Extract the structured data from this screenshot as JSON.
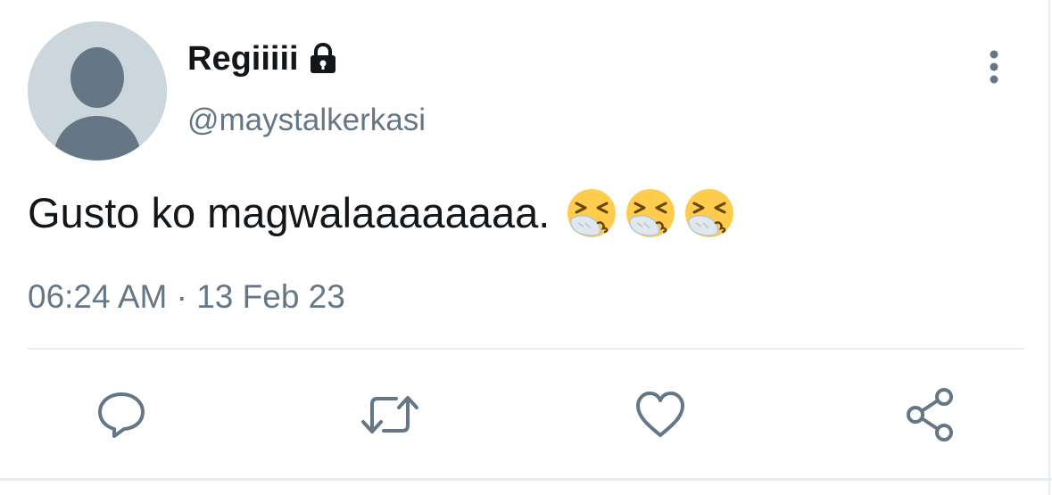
{
  "tweet": {
    "display_name": "Regiiiii",
    "handle": "@maystalkerkasi",
    "text": "Gusto ko magwalaaaaaaaa.",
    "emojis": [
      "sneezing-face-icon",
      "sneezing-face-icon",
      "sneezing-face-icon"
    ],
    "timestamp": "06:24 AM · 13 Feb 23",
    "protected_icon": "lock-icon"
  },
  "actions": {
    "reply_icon": "reply-icon",
    "retweet_icon": "retweet-icon",
    "like_icon": "heart-icon",
    "share_icon": "share-icon"
  },
  "colors": {
    "text_primary": "#14171a",
    "text_secondary": "#657786",
    "avatar_bg": "#ccd6dd",
    "avatar_fg": "#657786",
    "divider": "#e6ecf0",
    "emoji_face": "#ffcc4d",
    "emoji_tissue": "#e1e8ed"
  }
}
